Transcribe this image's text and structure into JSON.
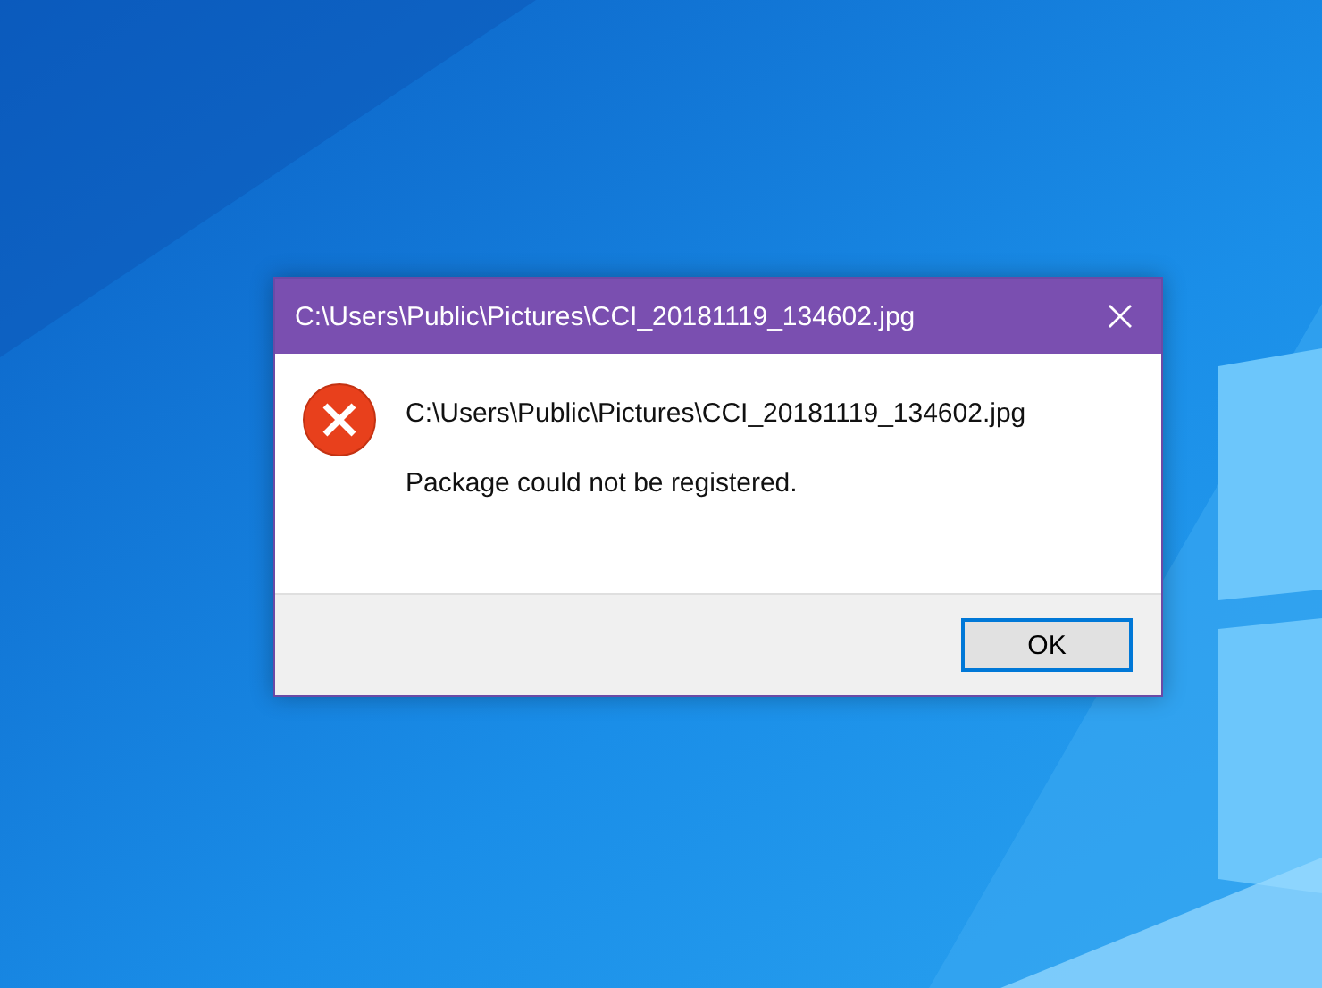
{
  "dialog": {
    "title": "C:\\Users\\Public\\Pictures\\CCI_20181119_134602.jpg",
    "kind": "error",
    "lines": [
      "C:\\Users\\Public\\Pictures\\CCI_20181119_134602.jpg",
      "Package could not be registered."
    ],
    "buttons": [
      {
        "label": "OK",
        "default": true
      }
    ]
  }
}
